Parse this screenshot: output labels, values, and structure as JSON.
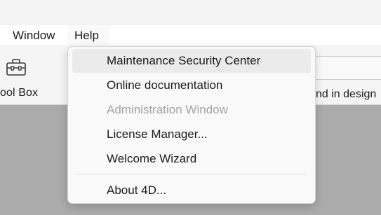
{
  "menubar": {
    "items": [
      {
        "label": "Window"
      },
      {
        "label": "Help"
      }
    ]
  },
  "toolbar": {
    "toolbox_label": "ool Box",
    "toolbox_icon": "toolbox-icon",
    "right_label": "nd in design"
  },
  "help_menu": {
    "items": [
      {
        "label": "Maintenance Security Center",
        "state": "highlighted"
      },
      {
        "label": "Online documentation",
        "state": "enabled"
      },
      {
        "label": "Administration Window",
        "state": "disabled"
      },
      {
        "label": "License Manager...",
        "state": "enabled"
      },
      {
        "label": "Welcome Wizard",
        "state": "enabled"
      },
      {
        "label": "About 4D...",
        "state": "enabled"
      }
    ]
  },
  "colors": {
    "highlight": "#ebebeb",
    "disabled_text": "#a3a3a3",
    "menu_background": "#f9f9f9",
    "workspace": "#ababab"
  }
}
